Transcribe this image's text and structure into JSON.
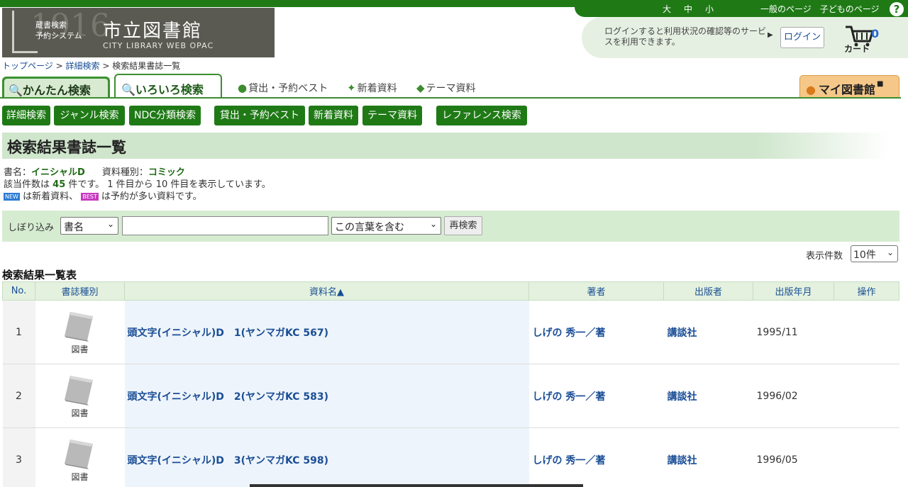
{
  "header": {
    "size_links": [
      "大",
      "中",
      "小"
    ],
    "page_links": [
      "一般のページ",
      "子どものページ"
    ],
    "help": "?",
    "logo": {
      "year": "1916",
      "system_line1": "蔵書検索",
      "system_line2": "予約システム",
      "name": "市立図書館",
      "subtitle": "CITY LIBRARY WEB OPAC"
    },
    "login_message": "ログインすると利用状況の確認等のサービスを利用できます。",
    "login_button": "ログイン",
    "cart_count": "0",
    "cart_label": "カート"
  },
  "breadcrumb": {
    "items": [
      "トップページ",
      "詳細検索",
      "検索結果書誌一覧"
    ],
    "separator": ">"
  },
  "tabs": {
    "easy": "かんたん検索",
    "various": "いろいろ検索",
    "links": [
      "貸出・予約ベスト",
      "新着資料",
      "テーマ資料"
    ],
    "mylib": "マイ図書館"
  },
  "buttons": [
    "詳細検索",
    "ジャンル検索",
    "NDC分類検索",
    "貸出・予約ベスト",
    "新着資料",
    "テーマ資料",
    "レファレンス検索"
  ],
  "page_title": "検索結果書誌一覧",
  "summary": {
    "title_label": "書名：",
    "title_value": "イニシャルD",
    "type_label": "資料種別：",
    "type_value": "コミック",
    "count_prefix": "該当件数は",
    "count": "45",
    "count_suffix": "件です。 1 件目から 10 件目を表示しています。",
    "badge_new": "NEW",
    "badge_new_text": "は新着資料、",
    "badge_best": "BEST",
    "badge_best_text": "は予約が多い資料です。"
  },
  "refine": {
    "label": "しぼり込み",
    "field_select": "書名",
    "input_value": "",
    "match_select": "この言葉を含む",
    "button": "再検索"
  },
  "display": {
    "label": "表示件数",
    "value": "10件"
  },
  "table": {
    "title": "検索結果一覧表",
    "headers": [
      "No.",
      "書誌種別",
      "資料名▲",
      "著者",
      "出版者",
      "出版年月",
      "操作"
    ],
    "rows": [
      {
        "no": "1",
        "type": "図書",
        "title": "頭文字(イニシャル)D　1(ヤンマガKC 567)",
        "author": "しげの 秀一／著",
        "publisher": "講談社",
        "date": "1995/11"
      },
      {
        "no": "2",
        "type": "図書",
        "title": "頭文字(イニシャル)D　2(ヤンマガKC 583)",
        "author": "しげの 秀一／著",
        "publisher": "講談社",
        "date": "1996/02"
      },
      {
        "no": "3",
        "type": "図書",
        "title": "頭文字(イニシャル)D　3(ヤンマガKC 598)",
        "author": "しげの 秀一／著",
        "publisher": "講談社",
        "date": "1996/05"
      }
    ]
  },
  "colors": {
    "brand_green": "#1f7a16",
    "light_green": "#d6ecd1",
    "link_blue": "#1a4e96"
  }
}
